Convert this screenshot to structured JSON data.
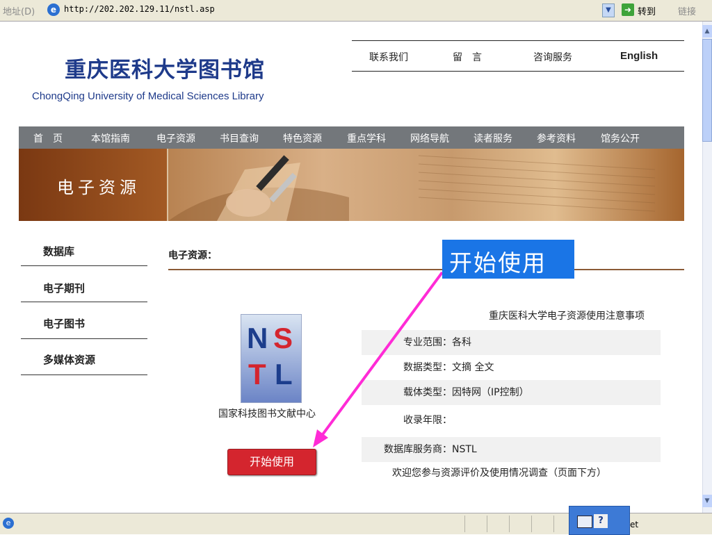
{
  "browser": {
    "address_label": "地址(D)",
    "url": "http://202.202.129.11/nstl.asp",
    "go_label": "转到",
    "links_label": "链接",
    "status_text": "et"
  },
  "header": {
    "title_cn": "重庆医科大学图书馆",
    "title_en": "ChongQing University of Medical Sciences Library",
    "top_links": [
      "联系我们",
      "留　言",
      "咨询服务",
      "English"
    ]
  },
  "main_nav": [
    "首　页",
    "本馆指南",
    "电子资源",
    "书目查询",
    "特色资源",
    "重点学科",
    "网络导航",
    "读者服务",
    "参考资料",
    "馆务公开"
  ],
  "banner": {
    "title": "电子资源"
  },
  "sidebar": {
    "items": [
      "数据库",
      "电子期刊",
      "电子图书",
      "多媒体资源"
    ]
  },
  "content": {
    "section_title": "电子资源：",
    "callout": "开始使用",
    "logo_letters": [
      "N",
      "S",
      "T",
      "L"
    ],
    "logo_caption": "国家科技图书文献中心",
    "start_button": "开始使用",
    "notice": "重庆医科大学电子资源使用注意事项",
    "info": [
      {
        "label": "专业范围：",
        "value": "各科"
      },
      {
        "label": "数据类型：",
        "value": "文摘 全文"
      },
      {
        "label": "载体类型：",
        "value": "因特网（IP控制）"
      },
      {
        "label": "收录年限：",
        "value": ""
      },
      {
        "label": "数据库服务商：",
        "value": "NSTL"
      }
    ],
    "survey": "欢迎您参与资源评价及使用情况调查（页面下方）"
  },
  "colors": {
    "title_blue": "#1e3a8a",
    "nav_gray": "#73777b",
    "banner_brown": "#7a3812",
    "button_red": "#d4252e",
    "callout_blue": "#1a75e6",
    "arrow_magenta": "#ff2bd6"
  }
}
